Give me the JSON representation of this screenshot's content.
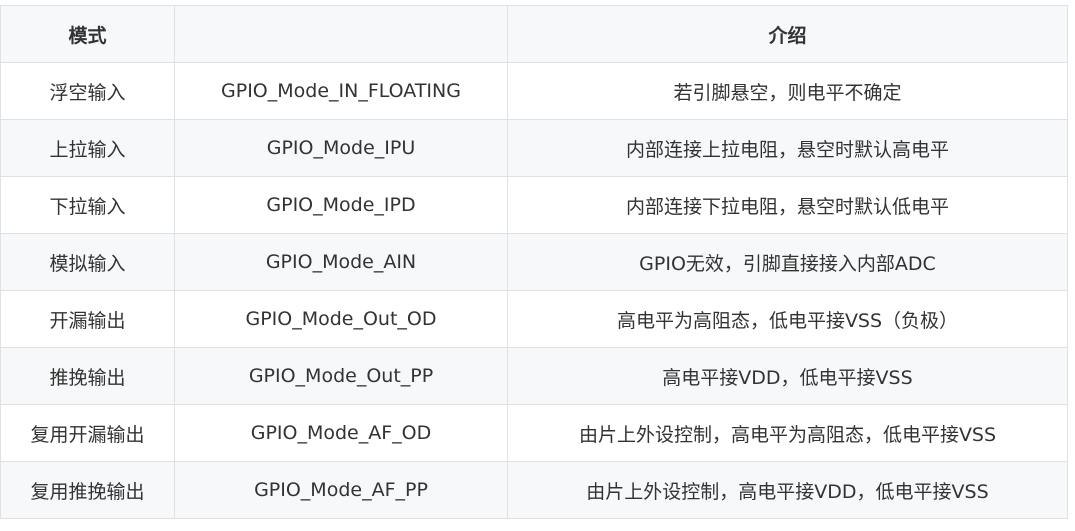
{
  "table": {
    "headers": [
      "模式",
      "",
      "介绍"
    ],
    "rows": [
      [
        "浮空输入",
        "GPIO_Mode_IN_FLOATING",
        "若引脚悬空，则电平不确定"
      ],
      [
        "上拉输入",
        "GPIO_Mode_IPU",
        "内部连接上拉电阻，悬空时默认高电平"
      ],
      [
        "下拉输入",
        "GPIO_Mode_IPD",
        "内部连接下拉电阻，悬空时默认低电平"
      ],
      [
        "模拟输入",
        "GPIO_Mode_AIN",
        "GPIO无效，引脚直接接入内部ADC"
      ],
      [
        "开漏输出",
        "GPIO_Mode_Out_OD",
        "高电平为高阻态，低电平接VSS（负极）"
      ],
      [
        "推挽输出",
        "GPIO_Mode_Out_PP",
        "高电平接VDD，低电平接VSS"
      ],
      [
        "复用开漏输出",
        "GPIO_Mode_AF_OD",
        "由片上外设控制，高电平为高阻态，低电平接VSS"
      ],
      [
        "复用推挽输出",
        "GPIO_Mode_AF_PP",
        "由片上外设控制，高电平接VDD，低电平接VSS"
      ]
    ]
  }
}
